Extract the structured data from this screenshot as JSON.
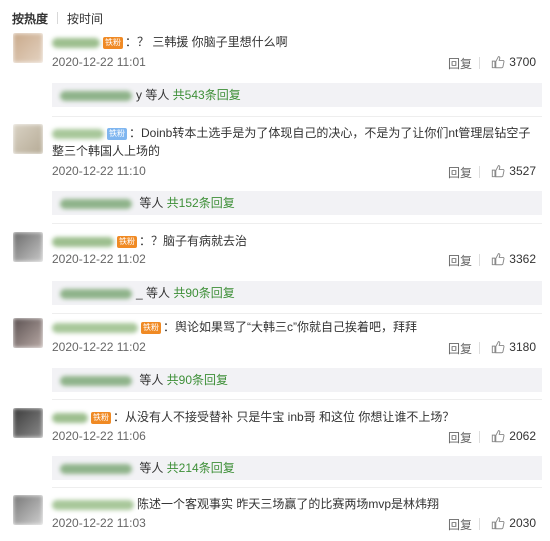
{
  "sort": {
    "hot_label": "按热度",
    "time_label": "按时间"
  },
  "colors": {
    "link_green": "#3d8f37",
    "fan_badge": "#f08a24",
    "sub_bg": "#f2f2f5"
  },
  "comments": [
    {
      "badge": "铁粉",
      "text": "：？ 三韩援 你脑子里想什么啊",
      "time": "2020-12-22 11:01",
      "reply_label": "回复",
      "likes": "3700",
      "sub": {
        "name_tail": "y",
        "others": " 等人 ",
        "count_label": "共543条回复"
      }
    },
    {
      "badge": "铁粉",
      "text": "：Doinb转本土选手是为了体现自己的决心，不是为了让你们nt管理层钻空子整三个韩国人上场的",
      "time": "2020-12-22 11:10",
      "reply_label": "回复",
      "likes": "3527",
      "sub": {
        "name_tail": "",
        "others": " 等人 ",
        "count_label": "共152条回复"
      }
    },
    {
      "badge": "铁粉",
      "text": "：？脑子有病就去治",
      "time": "2020-12-22 11:02",
      "reply_label": "回复",
      "likes": "3362",
      "sub": {
        "name_tail": "_",
        "others": " 等人 ",
        "count_label": "共90条回复"
      }
    },
    {
      "badge": "铁粉",
      "text": "：舆论如果骂了“大韩三c”你就自己挨着吧，拜拜",
      "time": "2020-12-22 11:02",
      "reply_label": "回复",
      "likes": "3180",
      "sub": {
        "name_tail": "",
        "others": " 等人 ",
        "count_label": "共90条回复"
      }
    },
    {
      "badge": "铁粉",
      "text": "：从没有人不接受替补 只是牛宝 inb哥 和这位 你想让谁不上场？",
      "time": "2020-12-22 11:06",
      "reply_label": "回复",
      "likes": "2062",
      "sub": {
        "name_tail": "",
        "others": " 等人 ",
        "count_label": "共214条回复"
      }
    },
    {
      "badge": "",
      "text": "陈述一个客观事实 昨天三场赢了的比赛两场mvp是林炜翔",
      "time": "2020-12-22 11:03",
      "reply_label": "回复",
      "likes": "2030"
    }
  ]
}
